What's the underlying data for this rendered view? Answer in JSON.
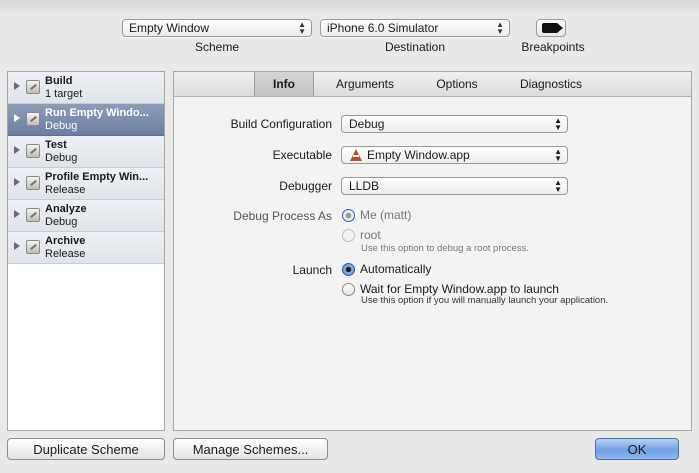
{
  "header": {
    "scheme_value": "Empty Window",
    "scheme_label": "Scheme",
    "destination_value": "iPhone 6.0 Simulator",
    "destination_label": "Destination",
    "breakpoints_label": "Breakpoints"
  },
  "sidebar": {
    "items": [
      {
        "title": "Build",
        "subtitle": "1 target",
        "selected": false
      },
      {
        "title": "Run Empty Windo...",
        "subtitle": "Debug",
        "selected": true
      },
      {
        "title": "Test",
        "subtitle": "Debug",
        "selected": false
      },
      {
        "title": "Profile Empty Win...",
        "subtitle": "Release",
        "selected": false
      },
      {
        "title": "Analyze",
        "subtitle": "Debug",
        "selected": false
      },
      {
        "title": "Archive",
        "subtitle": "Release",
        "selected": false
      }
    ]
  },
  "tabs": [
    "Info",
    "Arguments",
    "Options",
    "Diagnostics"
  ],
  "active_tab": "Info",
  "form": {
    "build_config_label": "Build Configuration",
    "build_config_value": "Debug",
    "executable_label": "Executable",
    "executable_value": "Empty Window.app",
    "debugger_label": "Debugger",
    "debugger_value": "LLDB",
    "debug_process_label": "Debug Process As",
    "debug_process_options": [
      {
        "label": "Me (matt)",
        "checked": true
      },
      {
        "label": "root",
        "checked": false,
        "hint": "Use this option to debug a root process."
      }
    ],
    "launch_label": "Launch",
    "launch_options": [
      {
        "label": "Automatically",
        "checked": true
      },
      {
        "label": "Wait for Empty Window.app to launch",
        "checked": false,
        "hint": "Use this option if you will manually launch your application."
      }
    ]
  },
  "buttons": {
    "duplicate": "Duplicate Scheme",
    "manage": "Manage Schemes...",
    "ok": "OK"
  },
  "colors": {
    "selection": "#7385a6",
    "primary_button": "#6fa2e3"
  }
}
